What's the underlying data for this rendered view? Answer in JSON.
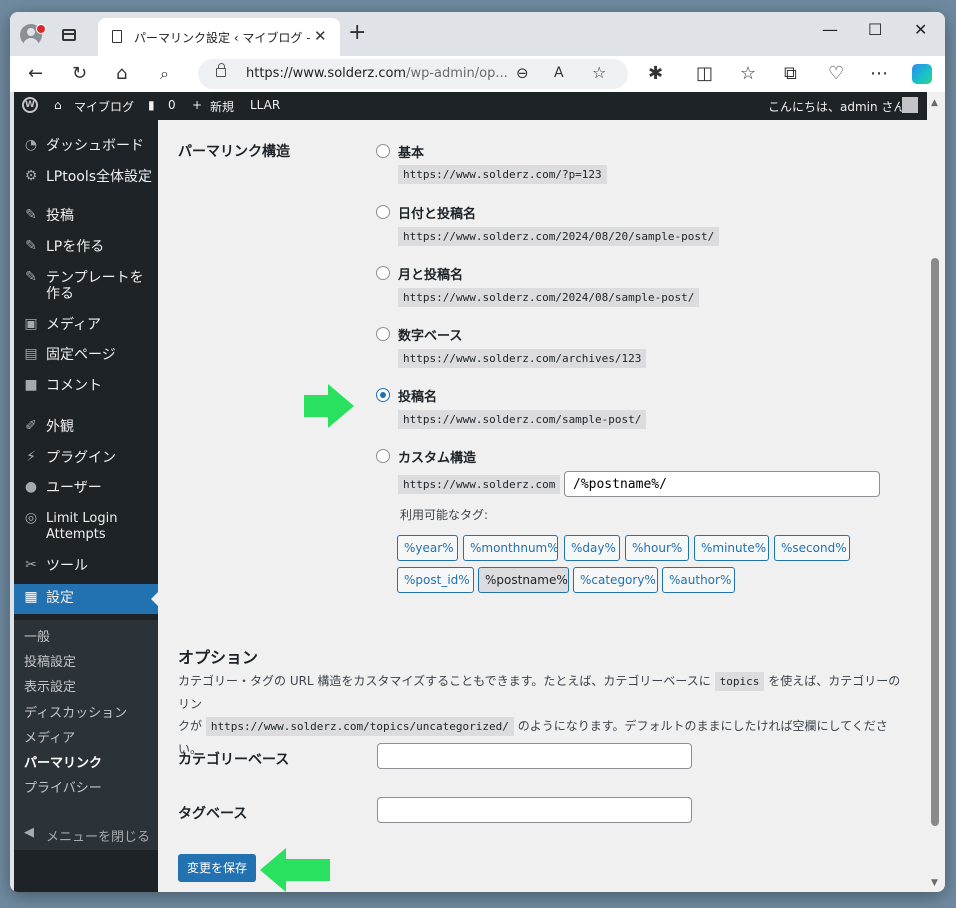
{
  "browser": {
    "tab_title": "パーマリンク設定 ‹ マイブログ — Wor",
    "tab_close": "✕",
    "new_tab": "+",
    "min": "—",
    "max": "☐",
    "close": "✕",
    "url_main": "https://www.solderz.com",
    "url_rest": "/wp-admin/op..."
  },
  "adminbar": {
    "site_name": "マイブログ",
    "comments_count": "0",
    "new_label": "新規",
    "llar": "LLAR",
    "greeting": "こんにちは、admin さん"
  },
  "sidebar": {
    "items": [
      {
        "icon": "dashboard-icon",
        "glyph": "◔",
        "label": "ダッシュボード"
      },
      {
        "icon": "gear-icon",
        "glyph": "⚙",
        "label": "LPtools全体設定"
      },
      {
        "icon": "pin-icon",
        "glyph": "✎",
        "label": "投稿"
      },
      {
        "icon": "pin-icon",
        "glyph": "✎",
        "label": "LPを作る"
      },
      {
        "icon": "pin-icon",
        "glyph": "✎",
        "label": "テンプレートを作る"
      },
      {
        "icon": "media-icon",
        "glyph": "▣",
        "label": "メディア"
      },
      {
        "icon": "page-icon",
        "glyph": "▤",
        "label": "固定ページ"
      },
      {
        "icon": "comment-icon",
        "glyph": "■",
        "label": "コメント"
      },
      {
        "icon": "appearance-icon",
        "glyph": "✐",
        "label": "外観"
      },
      {
        "icon": "plugin-icon",
        "glyph": "⚡",
        "label": "プラグイン"
      },
      {
        "icon": "user-icon",
        "glyph": "●",
        "label": "ユーザー"
      },
      {
        "icon": "fingerprint-icon",
        "glyph": "◎",
        "label": "Limit Login Attempts"
      },
      {
        "icon": "tools-icon",
        "glyph": "✂",
        "label": "ツール"
      },
      {
        "icon": "settings-icon",
        "glyph": "▦",
        "label": "設定"
      }
    ],
    "submenu": [
      "一般",
      "投稿設定",
      "表示設定",
      "ディスカッション",
      "メディア",
      "パーマリンク",
      "プライバシー"
    ],
    "collapse": "メニューを閉じる"
  },
  "permalink": {
    "heading": "パーマリンク構造",
    "options": [
      {
        "label": "基本",
        "example": "https://www.solderz.com/?p=123",
        "checked": false
      },
      {
        "label": "日付と投稿名",
        "example": "https://www.solderz.com/2024/08/20/sample-post/",
        "checked": false
      },
      {
        "label": "月と投稿名",
        "example": "https://www.solderz.com/2024/08/sample-post/",
        "checked": false
      },
      {
        "label": "数字ベース",
        "example": "https://www.solderz.com/archives/123",
        "checked": false
      },
      {
        "label": "投稿名",
        "example": "https://www.solderz.com/sample-post/",
        "checked": true
      },
      {
        "label": "カスタム構造",
        "example": "",
        "checked": false
      }
    ],
    "custom_prefix": "https://www.solderz.com",
    "custom_value": "/%postname%/",
    "tags_label": "利用可能なタグ:",
    "tags_row1": [
      "%year%",
      "%monthnum%",
      "%day%",
      "%hour%",
      "%minute%",
      "%second%"
    ],
    "tags_row2": [
      "%post_id%",
      "%postname%",
      "%category%",
      "%author%"
    ]
  },
  "options": {
    "title": "オプション",
    "desc_1": "カテゴリー・タグの URL 構造をカスタマイズすることもできます。たとえば、カテゴリーベースに",
    "desc_code1": "topics",
    "desc_2": "を使えば、カテゴリーのリン",
    "desc_3": "クが",
    "desc_code2": "https://www.solderz.com/topics/uncategorized/",
    "desc_4": "のようになります。デフォルトのままにしたければ空欄にしてください。",
    "category_base_label": "カテゴリーベース",
    "category_base_value": "",
    "tag_base_label": "タグベース",
    "tag_base_value": "",
    "save_label": "変更を保存"
  },
  "colors": {
    "accent": "#2271b1",
    "annotation_arrow": "#29e05f"
  }
}
